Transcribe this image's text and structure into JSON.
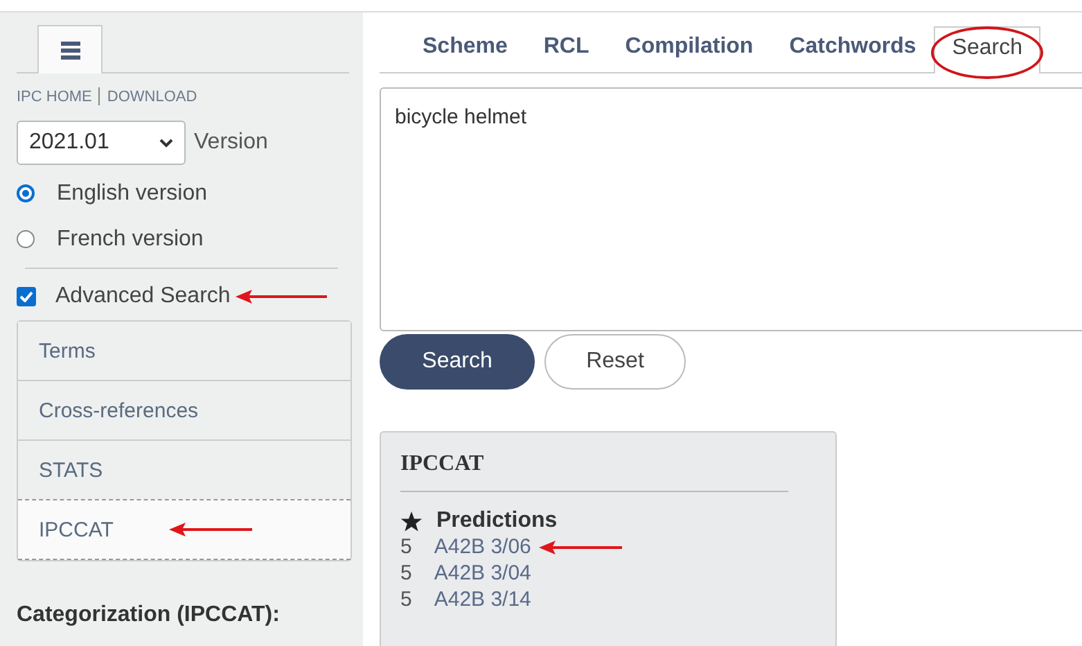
{
  "sidebar": {
    "links": [
      "IPC HOME",
      "DOWNLOAD"
    ],
    "version_select": {
      "value": "2021.01"
    },
    "version_label": "Version",
    "languages": [
      {
        "label": "English version",
        "selected": true
      },
      {
        "label": "French version",
        "selected": false
      }
    ],
    "advanced_search": {
      "label": "Advanced Search",
      "checked": true,
      "marked": true
    },
    "menu": [
      {
        "label": "Terms",
        "selected": false,
        "marked": false
      },
      {
        "label": "Cross-references",
        "selected": false,
        "marked": false
      },
      {
        "label": "STATS",
        "selected": false,
        "marked": false
      },
      {
        "label": "IPCCAT",
        "selected": true,
        "marked": true
      }
    ],
    "section_heading": "Categorization (IPCCAT):"
  },
  "tabs": [
    {
      "label": "Scheme",
      "selected": false,
      "marked": false
    },
    {
      "label": "RCL",
      "selected": false,
      "marked": false
    },
    {
      "label": "Compilation",
      "selected": false,
      "marked": false
    },
    {
      "label": "Catchwords",
      "selected": false,
      "marked": false
    },
    {
      "label": "Search",
      "selected": true,
      "marked": true
    }
  ],
  "query": {
    "value": "bicycle helmet"
  },
  "buttons": [
    {
      "label": "Search",
      "kind": "primary"
    },
    {
      "label": "Reset",
      "kind": "secondary"
    }
  ],
  "ipccat": {
    "title": "IPCCAT",
    "heading": "Predictions",
    "predictions": [
      {
        "score": "5",
        "code": "A42B 3/06",
        "marked": true
      },
      {
        "score": "5",
        "code": "A42B 3/04",
        "marked": false
      },
      {
        "score": "5",
        "code": "A42B 3/14",
        "marked": false
      }
    ]
  }
}
